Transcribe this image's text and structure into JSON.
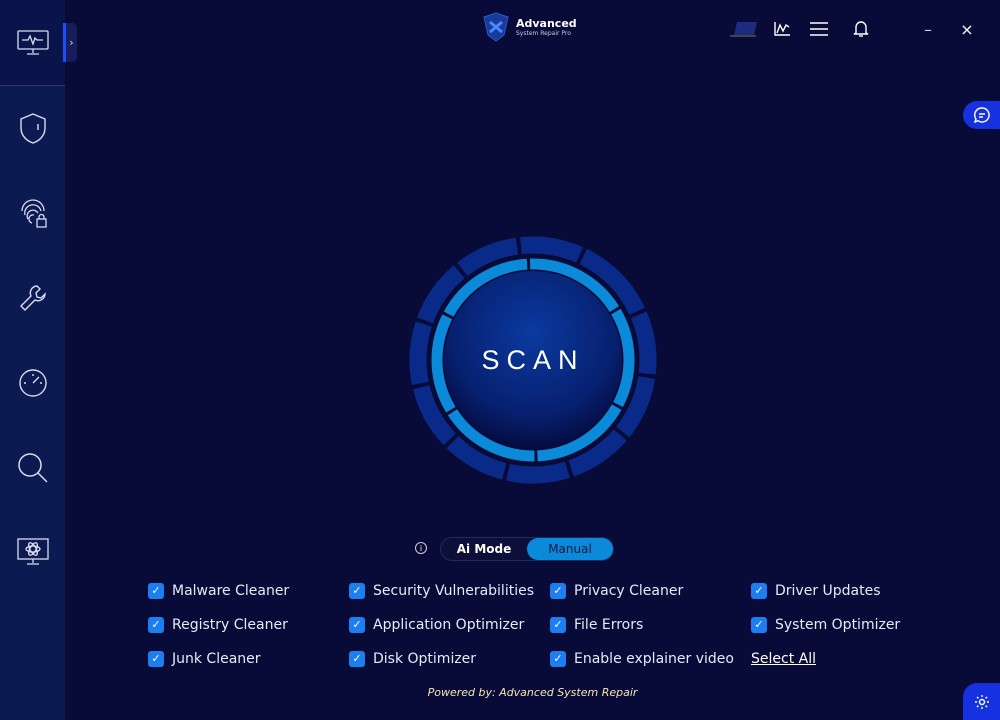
{
  "app": {
    "title_line1": "Advanced",
    "title_line2": "System Repair Pro"
  },
  "sidebar": {
    "items": [
      {
        "icon": "monitor-pulse-icon"
      },
      {
        "icon": "shield-icon"
      },
      {
        "icon": "fingerprint-lock-icon"
      },
      {
        "icon": "wrench-icon"
      },
      {
        "icon": "speedometer-icon"
      },
      {
        "icon": "search-icon"
      },
      {
        "icon": "monitor-atom-icon"
      }
    ],
    "collapse": "›"
  },
  "toolbar": {
    "minimize": "–",
    "close": "×"
  },
  "scan": {
    "label": "SCAN"
  },
  "mode": {
    "ai": "Ai Mode",
    "manual": "Manual",
    "selected": "Manual",
    "info": "i"
  },
  "options": [
    {
      "label": "Malware Cleaner",
      "checked": true
    },
    {
      "label": "Security Vulnerabilities",
      "checked": true
    },
    {
      "label": "Privacy Cleaner",
      "checked": true
    },
    {
      "label": "Driver Updates",
      "checked": true
    },
    {
      "label": "Registry Cleaner",
      "checked": true
    },
    {
      "label": "Application Optimizer",
      "checked": true
    },
    {
      "label": "File Errors",
      "checked": true
    },
    {
      "label": "System Optimizer",
      "checked": true
    },
    {
      "label": "Junk Cleaner",
      "checked": true
    },
    {
      "label": "Disk Optimizer",
      "checked": true
    },
    {
      "label": "Enable explainer video",
      "checked": true
    }
  ],
  "select_all": "Select All",
  "footer": "Powered by: Advanced System Repair",
  "colors": {
    "background": "#080a38",
    "sidebar": "#0c1a52",
    "accent": "#0a8ad8",
    "button": "#1631e0"
  }
}
